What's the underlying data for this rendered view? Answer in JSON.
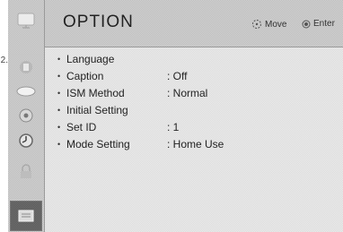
{
  "outer_marker": "2.",
  "header": {
    "title": "OPTION",
    "move_hint": "Move",
    "enter_hint": "Enter"
  },
  "sidebar": {
    "items": [
      {
        "icon": "tv-screen-icon",
        "selected": false
      },
      {
        "icon": "picture-icon",
        "selected": false
      },
      {
        "icon": "audio-icon",
        "selected": false
      },
      {
        "icon": "disc-icon",
        "selected": false
      },
      {
        "icon": "clock-icon",
        "selected": false
      },
      {
        "icon": "lock-icon",
        "selected": false
      },
      {
        "icon": "option-icon",
        "selected": true
      }
    ]
  },
  "menu": {
    "bullet": "•",
    "items": [
      {
        "label": "Language",
        "value": ""
      },
      {
        "label": "Caption",
        "value": ": Off"
      },
      {
        "label": "ISM Method",
        "value": ": Normal"
      },
      {
        "label": "Initial Setting",
        "value": ""
      },
      {
        "label": "Set ID",
        "value": ": 1"
      },
      {
        "label": "Mode Setting",
        "value": ": Home Use"
      }
    ]
  }
}
